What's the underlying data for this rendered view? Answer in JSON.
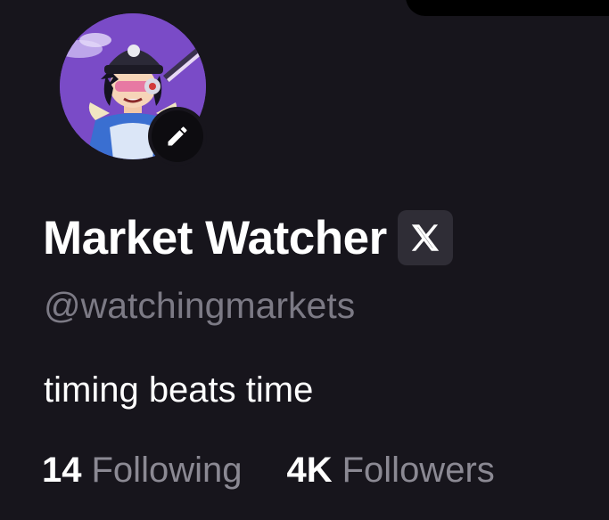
{
  "profile": {
    "display_name": "Market Watcher",
    "handle": "@watchingmarkets",
    "bio": "timing beats time",
    "verified_platform_icon": "x-logo-icon",
    "edit_icon": "pencil-icon"
  },
  "stats": {
    "following_count": "14",
    "following_label": "Following",
    "followers_count": "4K",
    "followers_label": "Followers"
  },
  "colors": {
    "background": "#17151c",
    "handle_text": "#7c7a85",
    "stat_label_text": "#8b8993",
    "avatar_background": "#7a4bc7",
    "badge_background": "#2f2d36"
  }
}
